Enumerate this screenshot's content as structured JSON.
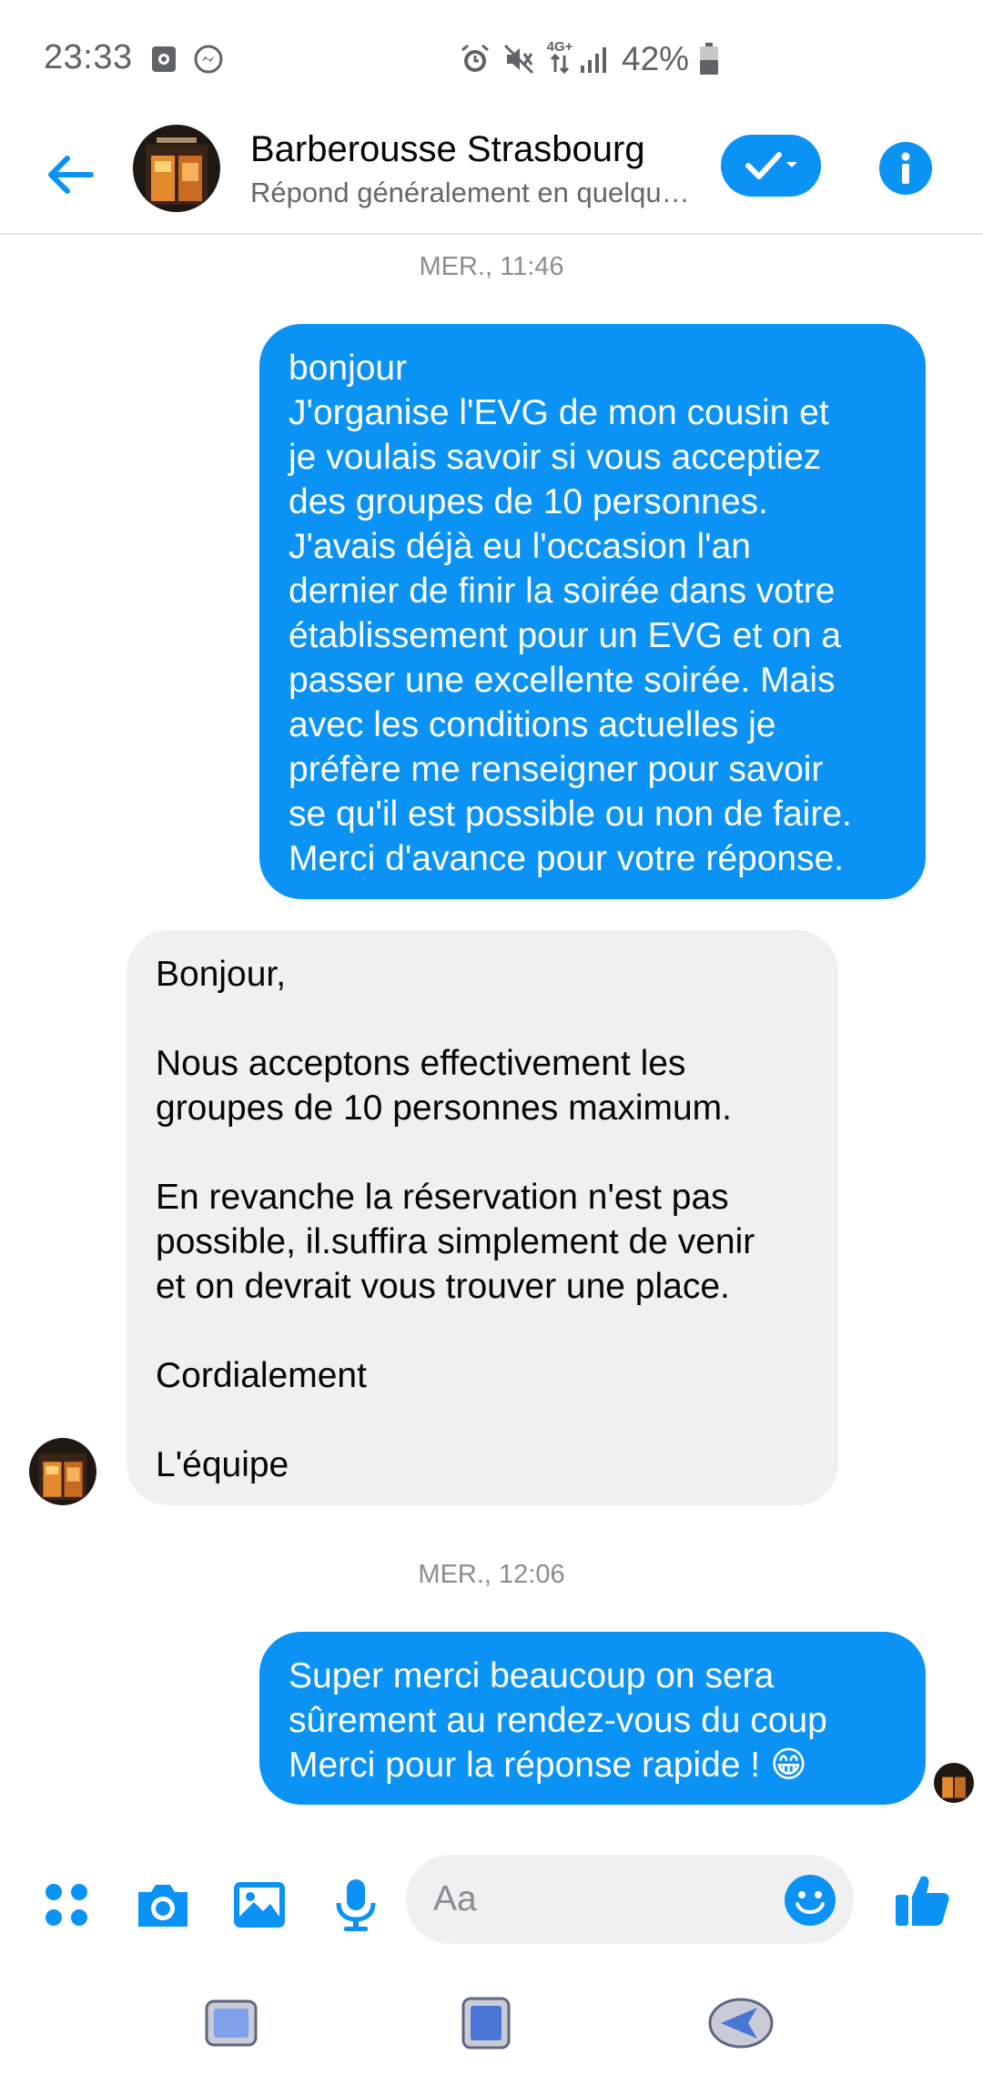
{
  "status_bar": {
    "time": "23:33",
    "battery_percent": "42%",
    "network_label": "4G+",
    "icons": [
      "notification-icon",
      "messenger-icon",
      "alarm-icon",
      "mute-icon",
      "network-4g-icon",
      "signal-icon",
      "battery-icon"
    ]
  },
  "header": {
    "contact_name": "Barberousse Strasbourg",
    "contact_subtitle": "Répond généralement en quelqu…",
    "accent_color": "#0a93f5"
  },
  "conversation": {
    "timestamp_1": "MER., 11:46",
    "message_1": "bonjour\nJ'organise l'EVG de mon cousin et\nje voulais savoir si vous acceptiez\ndes groupes de 10 personnes.\nJ'avais déjà eu l'occasion l'an\ndernier de finir la soirée dans votre\nétablissement pour un EVG et on a\npasser une excellente soirée. Mais\navec les conditions actuelles je\npréfère me renseigner pour savoir\nse qu'il est possible ou non de faire.\nMerci d'avance pour votre réponse.",
    "message_2": "Bonjour,\n\nNous acceptons effectivement les\ngroupes de 10 personnes maximum.\n\nEn revanche la réservation n'est pas\npossible, il.suffira simplement de venir\net on devrait vous trouver une place.\n\nCordialement\n\nL'équipe",
    "timestamp_2": "MER., 12:06",
    "message_3": "Super merci beaucoup on sera\nsûrement au rendez-vous du coup\nMerci pour la réponse rapide ! 😁"
  },
  "composer": {
    "placeholder": "Aa",
    "icons": [
      "apps-icon",
      "camera-icon",
      "gallery-icon",
      "microphone-icon",
      "emoji-icon",
      "thumbs-up-icon"
    ]
  },
  "navbar": {
    "icons": [
      "recent-apps-icon",
      "home-icon",
      "back-nav-icon"
    ]
  }
}
